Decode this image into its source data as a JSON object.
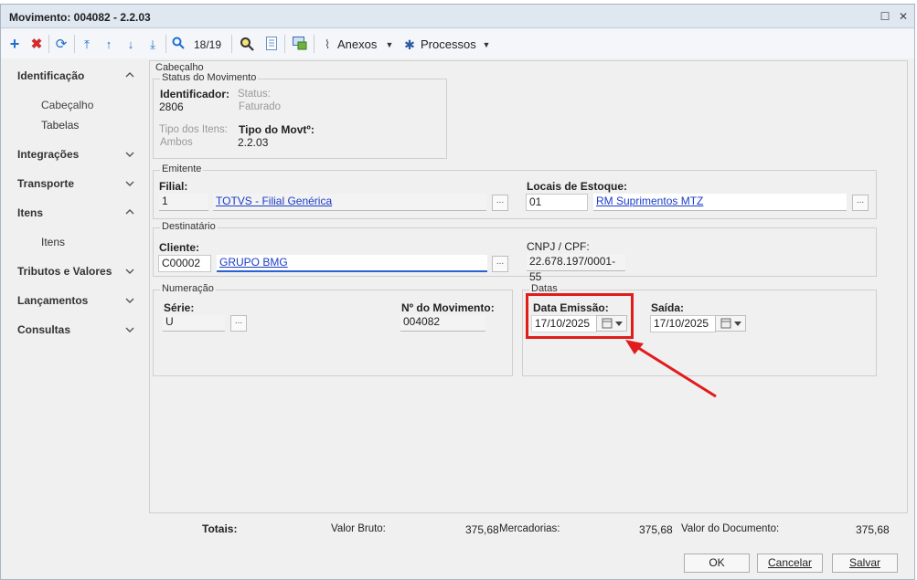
{
  "window": {
    "title": "Movimento: 004082 - 2.2.03"
  },
  "toolbar": {
    "counter": "18/19",
    "anexos": "Anexos",
    "processos": "Processos"
  },
  "nav": {
    "identificacao": "Identificação",
    "cabecalho": "Cabeçalho",
    "tabelas": "Tabelas",
    "integracoes": "Integrações",
    "transporte": "Transporte",
    "itens": "Itens",
    "itens_sub": "Itens",
    "tributos": "Tributos e Valores",
    "lancamentos": "Lançamentos",
    "consultas": "Consultas"
  },
  "cabecalho": {
    "legend": "Cabeçalho",
    "status_group": "Status do Movimento",
    "identificador_label": "Identificador:",
    "identificador_value": "2806",
    "status_label": "Status:",
    "status_value": "Faturado",
    "tipo_itens_label": "Tipo dos Itens:",
    "tipo_itens_value": "Ambos",
    "tipo_movto_label": "Tipo do Movtº:",
    "tipo_movto_value": "2.2.03"
  },
  "emitente": {
    "legend": "Emitente",
    "filial_label": "Filial:",
    "filial_code": "1",
    "filial_name": "TOTVS - Filial Genérica",
    "locais_label": "Locais de Estoque:",
    "locais_code": "01",
    "locais_name": "RM Suprimentos MTZ"
  },
  "destinatario": {
    "legend": "Destinatário",
    "cliente_label": "Cliente:",
    "cliente_code": "C00002",
    "cliente_name": "GRUPO BMG",
    "cnpj_label": "CNPJ / CPF:",
    "cnpj_value": "22.678.197/0001-55"
  },
  "numeracao": {
    "legend": "Numeração",
    "serie_label": "Série:",
    "serie_value": "U",
    "numero_label": "Nº do Movimento:",
    "numero_value": "004082"
  },
  "datas": {
    "legend": "Datas",
    "emissao_label": "Data Emissão:",
    "emissao_value": "17/10/2025",
    "saida_label": "Saída:",
    "saida_value": "17/10/2025"
  },
  "totais": {
    "label": "Totais:",
    "valor_bruto_label": "Valor Bruto:",
    "valor_bruto_value": "375,68",
    "mercadorias_label": "Mercadorias:",
    "mercadorias_value": "375,68",
    "valor_doc_label": "Valor do Documento:",
    "valor_doc_value": "375,68"
  },
  "buttons": {
    "ok": "OK",
    "cancelar": "Cancelar",
    "salvar": "Salvar"
  },
  "colors": {
    "accent": "#1a3cc8",
    "highlight": "#e21b1b",
    "add": "#1e6fd0",
    "delete": "#d22b2b"
  }
}
